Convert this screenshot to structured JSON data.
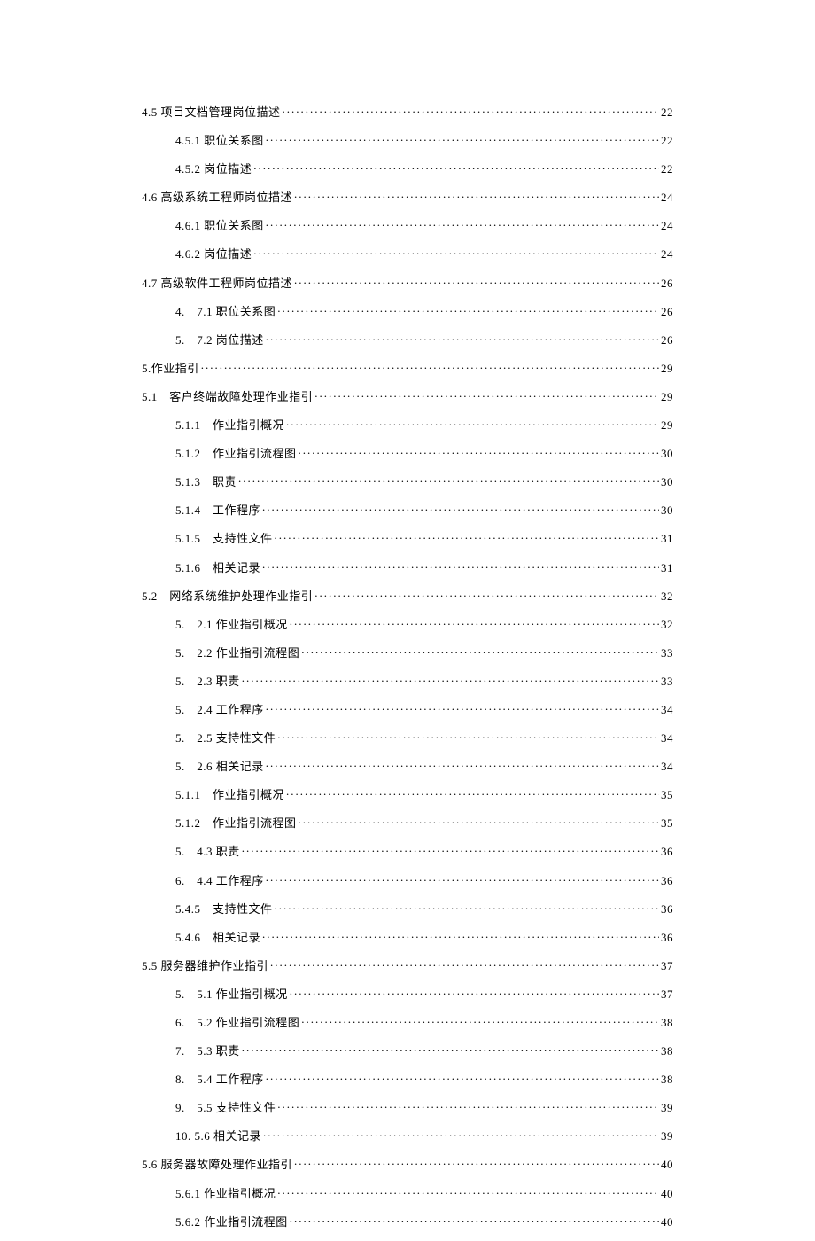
{
  "toc": [
    {
      "indent": 1,
      "label": "4.5 项目文档管理岗位描述",
      "page": "22"
    },
    {
      "indent": 2,
      "label": "4.5.1 职位关系图 ",
      "page": "22"
    },
    {
      "indent": 2,
      "label": "4.5.2 岗位描述 ",
      "page": "22"
    },
    {
      "indent": 1,
      "label": "4.6 高级系统工程师岗位描述",
      "page": "24"
    },
    {
      "indent": 2,
      "label": "4.6.1 职位关系图 ",
      "page": "24"
    },
    {
      "indent": 2,
      "label": "4.6.2 岗位描述 ",
      "page": "24"
    },
    {
      "indent": 1,
      "label": "4.7 高级软件工程师岗位描述",
      "page": "26"
    },
    {
      "indent": 2,
      "label": "4.　7.1 职位关系图",
      "page": "26"
    },
    {
      "indent": 2,
      "label": "5.　7.2 岗位描述",
      "page": "26"
    },
    {
      "indent": 1,
      "label": "5.作业指引 ",
      "page": "29"
    },
    {
      "indent": 1,
      "label": "5.1　客户终端故障处理作业指引",
      "page": "29"
    },
    {
      "indent": 2,
      "label": "5.1.1　作业指引概况",
      "page": "29"
    },
    {
      "indent": 2,
      "label": "5.1.2　作业指引流程图",
      "page": "30"
    },
    {
      "indent": 2,
      "label": "5.1.3　职责",
      "page": "30"
    },
    {
      "indent": 2,
      "label": "5.1.4　工作程序",
      "page": "30"
    },
    {
      "indent": 2,
      "label": "5.1.5　支持性文件",
      "page": "31"
    },
    {
      "indent": 2,
      "label": "5.1.6　相关记录",
      "page": "31"
    },
    {
      "indent": 1,
      "label": "5.2　网络系统维护处理作业指引 ",
      "page": "32"
    },
    {
      "indent": 2,
      "label": "5.　2.1 作业指引概况",
      "page": "32"
    },
    {
      "indent": 2,
      "label": "5.　2.2 作业指引流程图 ",
      "page": "33"
    },
    {
      "indent": 2,
      "label": "5.　2.3 职责",
      "page": "33"
    },
    {
      "indent": 2,
      "label": "5.　2.4 工作程序",
      "page": "34"
    },
    {
      "indent": 2,
      "label": "5.　2.5 支持性文件 ",
      "page": "34"
    },
    {
      "indent": 2,
      "label": "5.　2.6 相关记录 ",
      "page": "34"
    },
    {
      "indent": 2,
      "label": "5.1.1　作业指引概况 ",
      "page": "35"
    },
    {
      "indent": 2,
      "label": "5.1.2　作业指引流程图",
      "page": "35"
    },
    {
      "indent": 2,
      "label": "5.　4.3 职责 ",
      "page": "36"
    },
    {
      "indent": 2,
      "label": "6.　4.4 工作程序",
      "page": "36"
    },
    {
      "indent": 2,
      "label": "5.4.5　支持性文件",
      "page": "36"
    },
    {
      "indent": 2,
      "label": "5.4.6　相关记录",
      "page": "36"
    },
    {
      "indent": 1,
      "label": "5.5 服务器维护作业指引",
      "page": "37"
    },
    {
      "indent": 2,
      "label": "5.　5.1 作业指引概况 ",
      "page": "37"
    },
    {
      "indent": 2,
      "label": "6.　5.2 作业指引流程图 ",
      "page": "38"
    },
    {
      "indent": 2,
      "label": "7.　5.3 职责 ",
      "page": "38"
    },
    {
      "indent": 2,
      "label": "8.　5.4 工作程序 ",
      "page": "38"
    },
    {
      "indent": 2,
      "label": "9.　5.5 支持性文件 ",
      "page": "39"
    },
    {
      "indent": 2,
      "label": "10. 5.6 相关记录 ",
      "page": "39"
    },
    {
      "indent": 1,
      "label": "5.6 服务器故障处理作业指引",
      "page": "40"
    },
    {
      "indent": 2,
      "label": "5.6.1 作业指引概况 ",
      "page": "40"
    },
    {
      "indent": 2,
      "label": "5.6.2 作业指引流程图 ",
      "page": "40"
    }
  ]
}
